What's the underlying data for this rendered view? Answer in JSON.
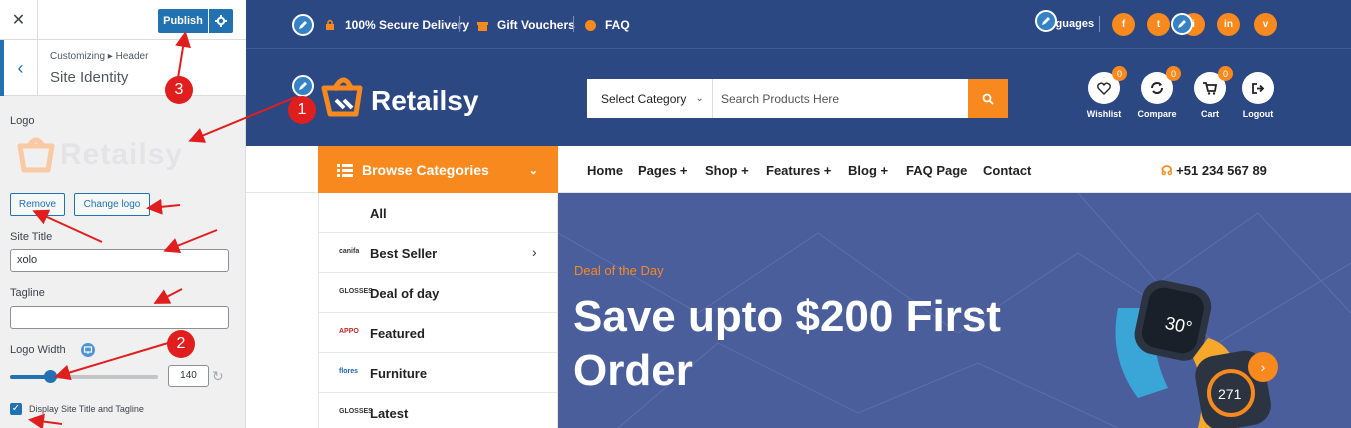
{
  "customizer": {
    "close_label": "✕",
    "publish_label": "Publish",
    "breadcrumb": "Customizing ▸ Header",
    "section_title": "Site Identity",
    "logo_label": "Logo",
    "logo_text": "Retailsy",
    "remove_label": "Remove",
    "change_logo_label": "Change logo",
    "site_title_label": "Site Title",
    "site_title_value": "xolo",
    "tagline_label": "Tagline",
    "tagline_value": "",
    "logo_width_label": "Logo Width",
    "logo_width_value": "140",
    "logo_width_slider_fraction": 0.27,
    "display_title_label": "Display Site Title and Tagline",
    "display_title_checked": true
  },
  "site": {
    "topbar": {
      "secure": "100% Secure Delivery",
      "vouchers": "Gift Vouchers",
      "faq": "FAQ",
      "languages": "Languages",
      "socials": [
        "f",
        "t",
        "i",
        "in",
        "v"
      ]
    },
    "brand": "Retailsy",
    "search": {
      "category": "Select Category",
      "placeholder": "Search Products Here"
    },
    "header_icons": [
      {
        "label": "Wishlist",
        "badge": "0",
        "icon": "heart-icon"
      },
      {
        "label": "Compare",
        "badge": "0",
        "icon": "refresh-icon"
      },
      {
        "label": "Cart",
        "badge": "0",
        "icon": "cart-icon"
      },
      {
        "label": "Logout",
        "badge": "",
        "icon": "logout-icon"
      }
    ],
    "browse_label": "Browse Categories",
    "nav": [
      "Home",
      "Pages +",
      "Shop +",
      "Features +",
      "Blog +",
      "FAQ Page",
      "Contact"
    ],
    "phone": "+51 234 567 89",
    "categories": [
      {
        "logo": "",
        "name": "All"
      },
      {
        "logo": "canifa",
        "name": "Best Seller"
      },
      {
        "logo": "GLOSSES",
        "name": "Deal of day"
      },
      {
        "logo": "APPO",
        "name": "Featured"
      },
      {
        "logo": "flores",
        "name": "Furniture"
      },
      {
        "logo": "GLOSSES",
        "name": "Latest"
      }
    ],
    "hero": {
      "kicker": "Deal of the Day",
      "headline": "Save upto $200 First Order",
      "watch_1": "30°",
      "watch_2": "271"
    }
  },
  "annotations": [
    "1",
    "2",
    "3"
  ],
  "colors": {
    "wp_blue": "#2271b1",
    "site_navy": "#2c4882",
    "hero_blue": "#4a5e9c",
    "accent_orange": "#f7891f",
    "annotation_red": "#e01e1e"
  }
}
